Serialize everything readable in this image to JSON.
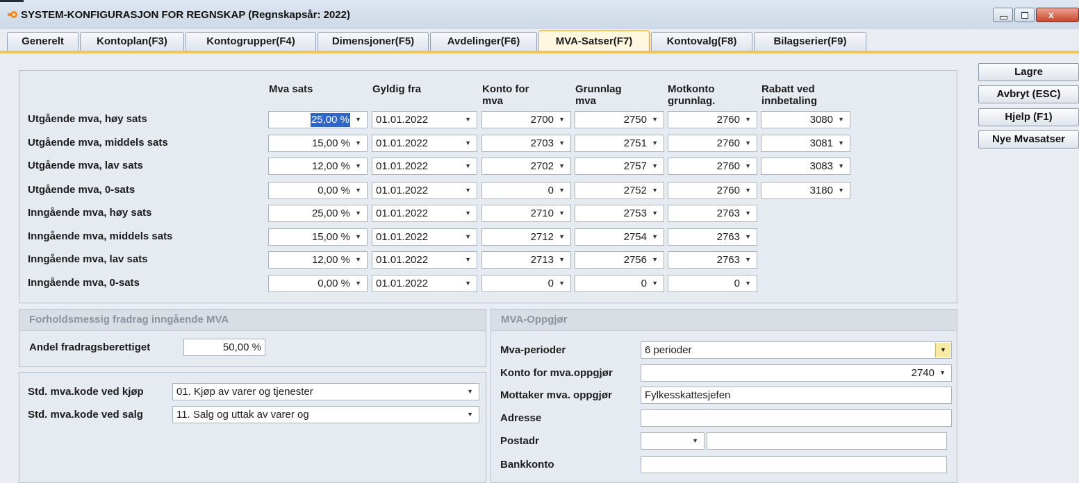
{
  "window": {
    "title": "SYSTEM-KONFIGURASJON FOR REGNSKAP  (Regnskapsår: 2022)",
    "close_glyph": "x"
  },
  "tabs": [
    {
      "label": "Generelt",
      "active": false
    },
    {
      "label": "Kontoplan(F3)",
      "active": false
    },
    {
      "label": "Kontogrupper(F4)",
      "active": false
    },
    {
      "label": "Dimensjoner(F5)",
      "active": false
    },
    {
      "label": "Avdelinger(F6)",
      "active": false
    },
    {
      "label": "MVA-Satser(F7)",
      "active": true
    },
    {
      "label": "Kontovalg(F8)",
      "active": false
    },
    {
      "label": "Bilagserier(F9)",
      "active": false
    }
  ],
  "side_buttons": {
    "save": "Lagre",
    "cancel": "Avbryt (ESC)",
    "help": "Hjelp (F1)",
    "new_rates": "Nye Mvasatser"
  },
  "vat_table": {
    "headers": {
      "rate": "Mva sats",
      "valid_from": "Gyldig fra",
      "account_1": "Konto for",
      "account_2": "mva",
      "basis_1": "Grunnlag",
      "basis_2": "mva",
      "counter_1": "Motkonto",
      "counter_2": "grunnlag.",
      "discount_1": "Rabatt ved",
      "discount_2": "innbetaling"
    },
    "rows": [
      {
        "label": "Utgående mva, høy sats",
        "rate": "25,00 %",
        "valid_from": "01.01.2022",
        "account": "2700",
        "basis": "2750",
        "counter": "2760",
        "discount": "3080"
      },
      {
        "label": "Utgående mva, middels sats",
        "rate": "15,00 %",
        "valid_from": "01.01.2022",
        "account": "2703",
        "basis": "2751",
        "counter": "2760",
        "discount": "3081"
      },
      {
        "label": "Utgående mva, lav sats",
        "rate": "12,00 %",
        "valid_from": "01.01.2022",
        "account": "2702",
        "basis": "2757",
        "counter": "2760",
        "discount": "3083"
      },
      {
        "label": "Utgående mva, 0-sats",
        "rate": "0,00 %",
        "valid_from": "01.01.2022",
        "account": "0",
        "basis": "2752",
        "counter": "2760",
        "discount": "3180"
      },
      {
        "label": "Inngående mva, høy sats",
        "rate": "25,00 %",
        "valid_from": "01.01.2022",
        "account": "2710",
        "basis": "2753",
        "counter": "2763",
        "discount": null
      },
      {
        "label": "Inngående mva, middels sats",
        "rate": "15,00 %",
        "valid_from": "01.01.2022",
        "account": "2712",
        "basis": "2754",
        "counter": "2763",
        "discount": null
      },
      {
        "label": "Inngående mva, lav sats",
        "rate": "12,00 %",
        "valid_from": "01.01.2022",
        "account": "2713",
        "basis": "2756",
        "counter": "2763",
        "discount": null
      },
      {
        "label": "Inngående mva, 0-sats",
        "rate": "0,00 %",
        "valid_from": "01.01.2022",
        "account": "0",
        "basis": "0",
        "counter": "0",
        "discount": null
      }
    ]
  },
  "proportional_deduction": {
    "header": "Forholdsmessig fradrag inngående MVA",
    "share_label": "Andel fradragsberettiget",
    "share_value": "50,00 %"
  },
  "std_codes": {
    "purchase_label": "Std. mva.kode ved kjøp",
    "purchase_value": "01. Kjøp av varer og tjenester",
    "sale_label": "Std. mva.kode ved salg",
    "sale_value": "11. Salg og uttak av varer og"
  },
  "vat_settlement": {
    "header": "MVA-Oppgjør",
    "periods_label": "Mva-perioder",
    "periods_value": "6 perioder",
    "account_label": "Konto for mva.oppgjør",
    "account_value": "2740",
    "recipient_label": "Mottaker mva. oppgjør",
    "recipient_value": "Fylkesskattesjefen",
    "address_label": "Adresse",
    "address_value": "",
    "postal_label": "Postadr",
    "postal_code": "",
    "postal_place": "",
    "bank_label": "Bankkonto",
    "bank_value": ""
  },
  "colors": {
    "tab_accent": "#f5c15b",
    "selection": "#2f66cd",
    "close_button": "#c8462c"
  },
  "icons": {
    "app": "orange-cog-icon",
    "dropdown": "triangle-down-icon"
  }
}
